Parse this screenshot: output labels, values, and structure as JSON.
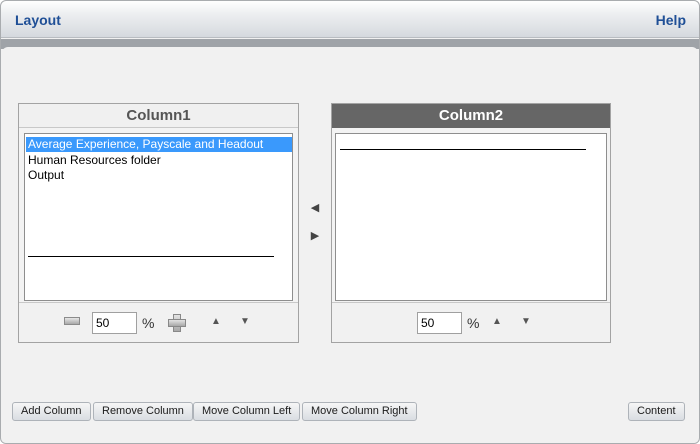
{
  "header": {
    "title": "Layout",
    "help_label": "Help"
  },
  "column1": {
    "title": "Column1",
    "items": [
      {
        "label": "Average Experience, Payscale and Headout",
        "selected": true
      },
      {
        "label": "Human Resources folder",
        "selected": false
      },
      {
        "label": "Output",
        "selected": false
      }
    ],
    "percent_value": "50",
    "percent_sign": "%"
  },
  "column2": {
    "title": "Column2",
    "percent_value": "50",
    "percent_sign": "%"
  },
  "icons": {
    "move_left": "◀",
    "move_right": "▶",
    "up": "▲",
    "down": "▼"
  },
  "footer": {
    "add_column": "Add Column",
    "remove_column": "Remove Column",
    "move_column_left": "Move Column Left",
    "move_column_right": "Move Column Right",
    "content": "Content"
  },
  "colors": {
    "header_text": "#1f4f96",
    "selection": "#3a99fc",
    "active_column_header": "#666666"
  }
}
